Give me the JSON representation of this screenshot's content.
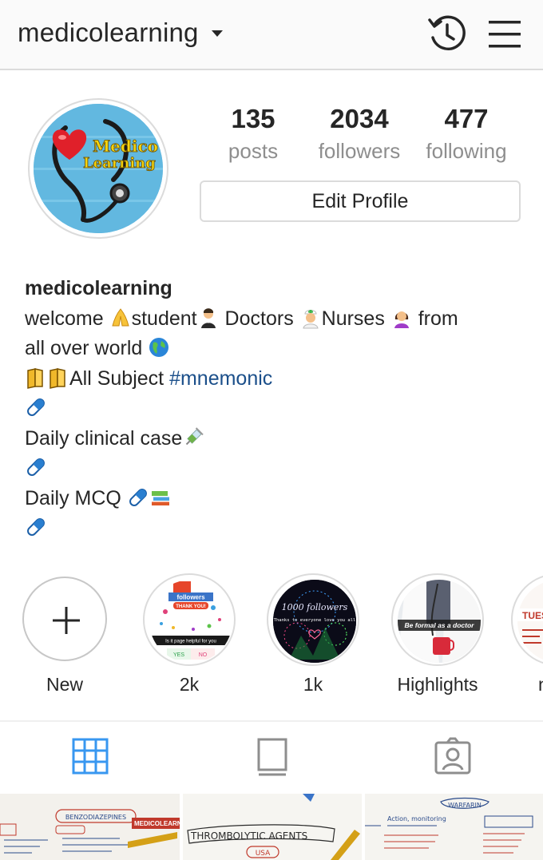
{
  "header": {
    "username": "medicolearning",
    "icons": {
      "history": "history-icon",
      "menu": "menu-icon",
      "dropdown": "chevron-down-icon"
    }
  },
  "avatar": {
    "text_line1": "Medico",
    "text_line2": "Learning"
  },
  "stats": {
    "posts": {
      "value": "135",
      "label": "posts"
    },
    "followers": {
      "value": "2034",
      "label": "followers"
    },
    "following": {
      "value": "477",
      "label": "following"
    }
  },
  "edit_profile_label": "Edit Profile",
  "bio": {
    "name": "medicolearning",
    "line1_a": "welcome ",
    "line1_b": "student",
    "line1_c": " Doctors ",
    "line1_d": "Nurses ",
    "line1_e": " from",
    "line2": "all over world ",
    "line3_text": "All Subject ",
    "line3_hashtag": "#mnemonic",
    "line5": " Daily clinical case",
    "line7": "Daily  MCQ "
  },
  "highlights": [
    {
      "label": "New",
      "icon": "plus-icon"
    },
    {
      "label": "2k",
      "cover_title": "followers",
      "cover_sub": "THANK YOU!",
      "cover_q": "Is it page helpful for you",
      "cover_yes": "YES",
      "cover_no": "NO"
    },
    {
      "label": "1k",
      "cover_title": "1000 followers",
      "cover_sub": "Thanks to everyone love you all"
    },
    {
      "label": "Highlights",
      "cover_title": "Be formal as a doctor"
    },
    {
      "label": "n",
      "cover_title": "TUESD"
    }
  ],
  "tabs": [
    {
      "name": "grid",
      "icon": "grid-icon",
      "active": true
    },
    {
      "name": "feed",
      "icon": "feed-icon",
      "active": false
    },
    {
      "name": "tagged",
      "icon": "tagged-icon",
      "active": false
    }
  ],
  "grid_posts": [
    {
      "title": "BENZODIAZEPINES",
      "tag": "MEDICOLEARNING"
    },
    {
      "title": "THROMBOLYTIC AGENTS",
      "sub": "USA"
    },
    {
      "title": "WARFARIN",
      "sub": "Action, monitoring"
    }
  ],
  "colors": {
    "accent_blue": "#3897f0",
    "hashtag": "#1b4f8a",
    "text": "#262626",
    "muted": "#8e8e8e",
    "border": "#dbdbdb"
  }
}
